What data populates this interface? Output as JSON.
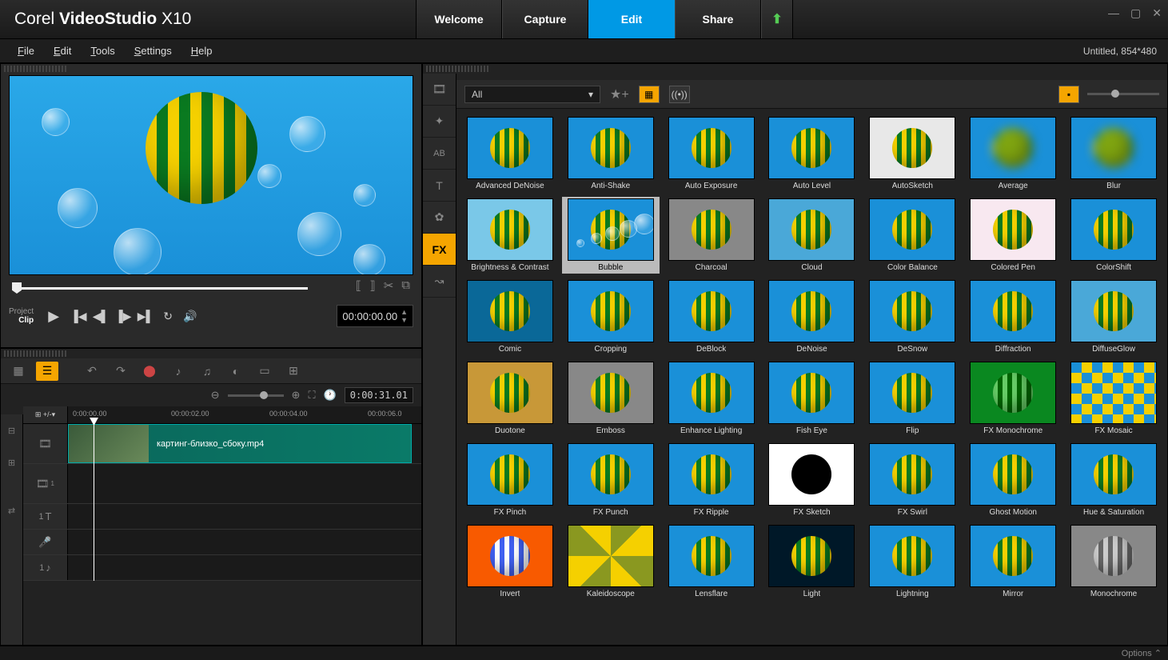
{
  "app": {
    "brand": "Corel",
    "name": "VideoStudio",
    "version": "X10"
  },
  "modeTabs": [
    "Welcome",
    "Capture",
    "Edit",
    "Share"
  ],
  "activeMode": "Edit",
  "menu": [
    "File",
    "Edit",
    "Tools",
    "Settings",
    "Help"
  ],
  "project": {
    "title": "Untitled",
    "dims": "854*480"
  },
  "preview": {
    "projectLabel": "Project",
    "clipLabel": "Clip",
    "timecode": "00:00:00.00"
  },
  "timeline": {
    "duration": "0:00:31.01",
    "ruler": [
      "0:00:00.00",
      "00:00:02.00",
      "00:00:04.00",
      "00:00:06.0"
    ],
    "clipName": "картинг-близко_сбоку.mp4"
  },
  "library": {
    "filter": "All",
    "sideTabs": [
      "media",
      "transitions",
      "title-ab",
      "text-t",
      "graphics",
      "fx",
      "path"
    ],
    "activeSide": "fx",
    "selected": "Bubble",
    "effects": [
      {
        "name": "Advanced DeNoise",
        "bg": "#1a90d8"
      },
      {
        "name": "Anti-Shake",
        "bg": "#1a90d8"
      },
      {
        "name": "Auto Exposure",
        "bg": "#1a90d8"
      },
      {
        "name": "Auto Level",
        "bg": "#1a90d8"
      },
      {
        "name": "AutoSketch",
        "bg": "#e8e8e8"
      },
      {
        "name": "Average",
        "bg": "#1a90d8",
        "blur": true
      },
      {
        "name": "Blur",
        "bg": "#1a90d8",
        "blur": true
      },
      {
        "name": "Brightness & Contrast",
        "bg": "#7ac8e8"
      },
      {
        "name": "Bubble",
        "bg": "#1a90d8",
        "bubbles": true
      },
      {
        "name": "Charcoal",
        "bg": "#888"
      },
      {
        "name": "Cloud",
        "bg": "#4aa8d8"
      },
      {
        "name": "Color Balance",
        "bg": "#1a90d8"
      },
      {
        "name": "Colored Pen",
        "bg": "#f8e8f0"
      },
      {
        "name": "ColorShift",
        "bg": "#1a90d8"
      },
      {
        "name": "Comic",
        "bg": "#0a6898"
      },
      {
        "name": "Cropping",
        "bg": "#1a90d8"
      },
      {
        "name": "DeBlock",
        "bg": "#1a90d8"
      },
      {
        "name": "DeNoise",
        "bg": "#1a90d8"
      },
      {
        "name": "DeSnow",
        "bg": "#1a90d8"
      },
      {
        "name": "Diffraction",
        "bg": "#1a90d8"
      },
      {
        "name": "DiffuseGlow",
        "bg": "#4aa8d8"
      },
      {
        "name": "Duotone",
        "bg": "#c89838"
      },
      {
        "name": "Emboss",
        "bg": "#888"
      },
      {
        "name": "Enhance Lighting",
        "bg": "#1a90d8"
      },
      {
        "name": "Fish Eye",
        "bg": "#1a90d8"
      },
      {
        "name": "Flip",
        "bg": "#1a90d8"
      },
      {
        "name": "FX Monochrome",
        "bg": "#0a8820"
      },
      {
        "name": "FX Mosaic",
        "bg": "#1a90d8",
        "mosaic": true
      },
      {
        "name": "FX Pinch",
        "bg": "#1a90d8"
      },
      {
        "name": "FX Punch",
        "bg": "#1a90d8"
      },
      {
        "name": "FX Ripple",
        "bg": "#1a90d8"
      },
      {
        "name": "FX Sketch",
        "bg": "#fff",
        "dark": true
      },
      {
        "name": "FX Swirl",
        "bg": "#1a90d8"
      },
      {
        "name": "Ghost Motion",
        "bg": "#1a90d8"
      },
      {
        "name": "Hue & Saturation",
        "bg": "#1a90d8"
      },
      {
        "name": "Invert",
        "bg": "#f85a00"
      },
      {
        "name": "Kaleidoscope",
        "bg": "#8a9820"
      },
      {
        "name": "Lensflare",
        "bg": "#1a90d8"
      },
      {
        "name": "Light",
        "bg": "#001828"
      },
      {
        "name": "Lightning",
        "bg": "#1a90d8"
      },
      {
        "name": "Mirror",
        "bg": "#1a90d8"
      },
      {
        "name": "Monochrome",
        "bg": "#888"
      }
    ]
  },
  "statusbar": {
    "options": "Options"
  }
}
